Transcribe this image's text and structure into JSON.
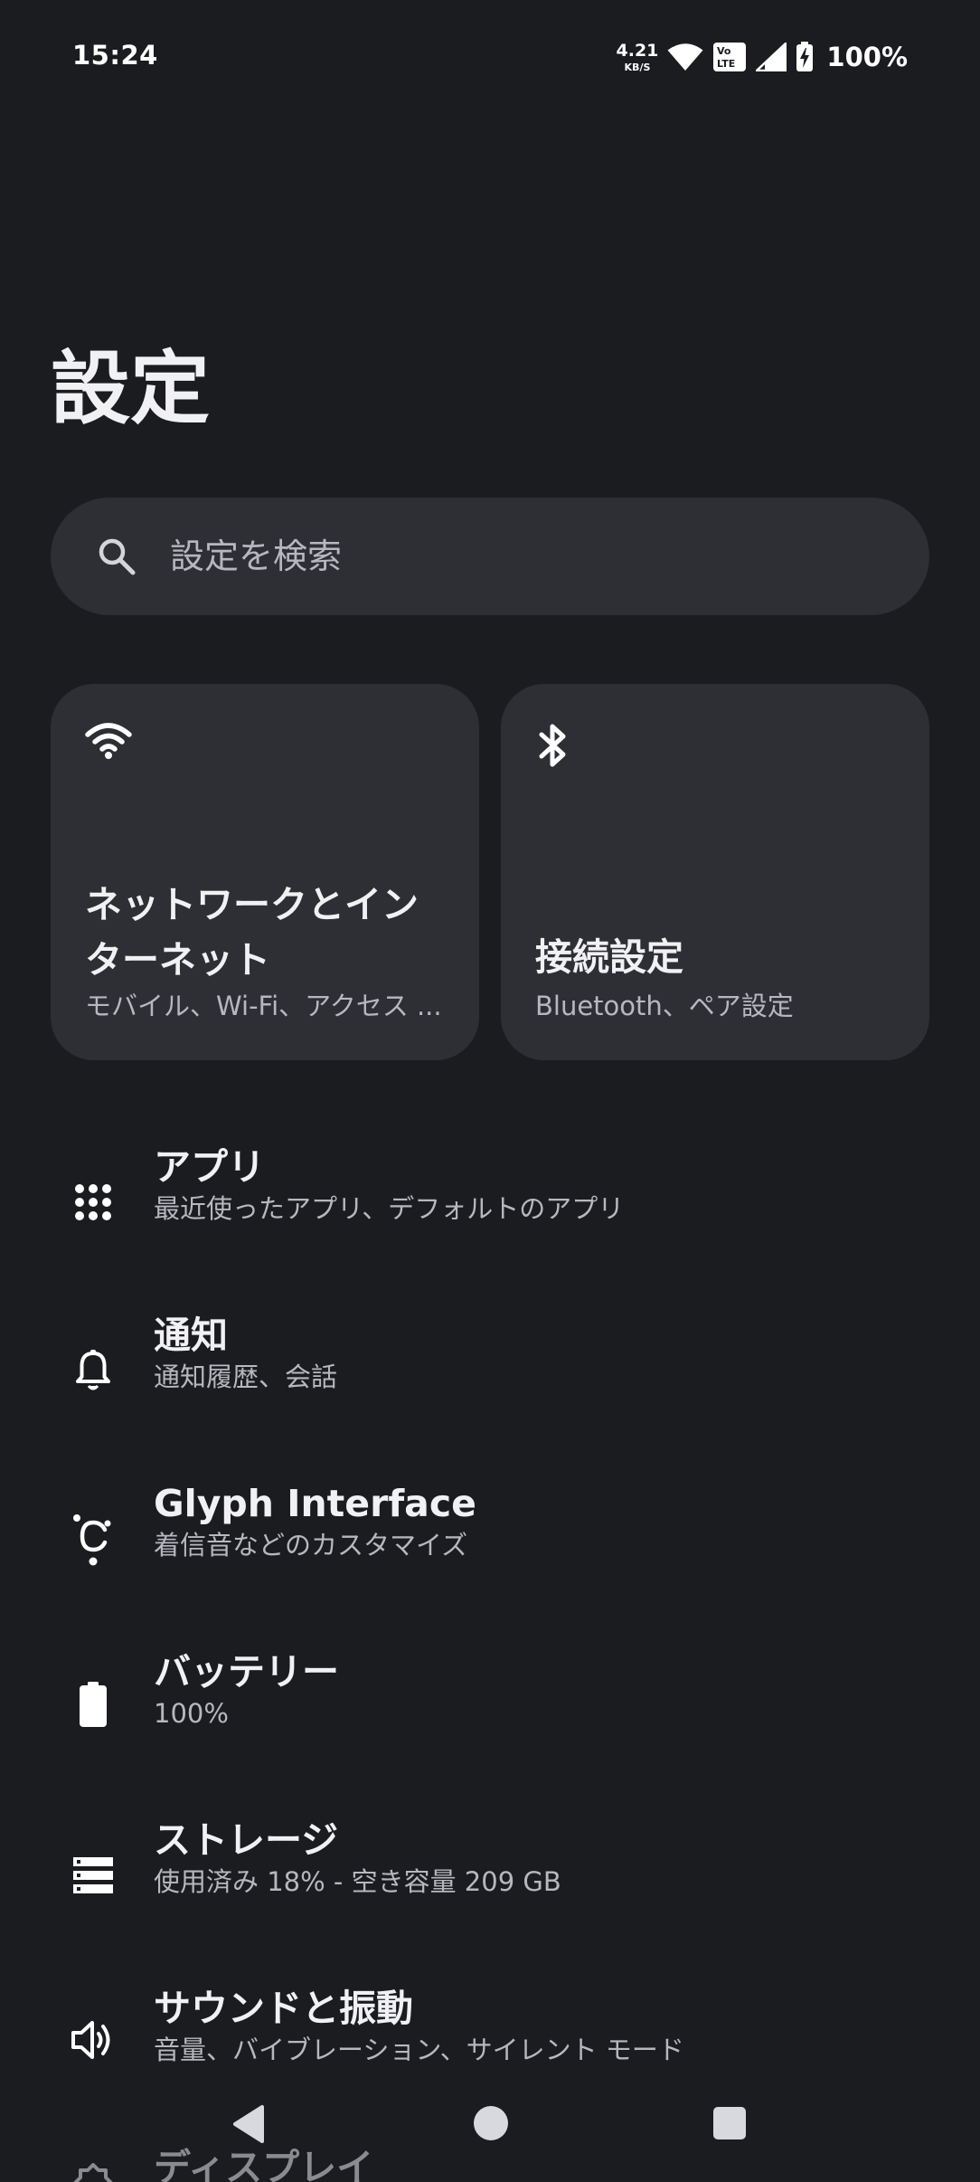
{
  "status_bar": {
    "time": "15:24",
    "net_speed_value": "4.21",
    "net_speed_unit": "KB/S",
    "volte_label_top": "Vo",
    "volte_label_bottom": "LTE",
    "battery_percent": "100%"
  },
  "page": {
    "title": "設定"
  },
  "search": {
    "placeholder": "設定を検索"
  },
  "cards": [
    {
      "icon": "wifi-icon",
      "title": "ネットワークとインターネット",
      "subtitle": "モバイル、Wi-Fi、アクセス ..."
    },
    {
      "icon": "bluetooth-icon",
      "title": "接続設定",
      "subtitle": "Bluetooth、ペア設定"
    }
  ],
  "settings": [
    {
      "icon": "apps-grid-icon",
      "title": "アプリ",
      "subtitle": "最近使ったアプリ、デフォルトのアプリ"
    },
    {
      "icon": "bell-icon",
      "title": "通知",
      "subtitle": "通知履歴、会話"
    },
    {
      "icon": "glyph-icon",
      "title": "Glyph Interface",
      "subtitle": "着信音などのカスタマイズ"
    },
    {
      "icon": "battery-icon",
      "title": "バッテリー",
      "subtitle": "100%"
    },
    {
      "icon": "storage-icon",
      "title": "ストレージ",
      "subtitle": "使用済み 18% - 空き容量 209 GB"
    },
    {
      "icon": "speaker-icon",
      "title": "サウンドと振動",
      "subtitle": "音量、バイブレーション、サイレント モード"
    },
    {
      "icon": "display-icon",
      "title": "ディスプレイ",
      "subtitle": ""
    }
  ],
  "colors": {
    "background": "#1b1c20",
    "surface": "#2e2f34",
    "text_primary": "#f1f1f4",
    "text_secondary": "#b7b8bf"
  }
}
